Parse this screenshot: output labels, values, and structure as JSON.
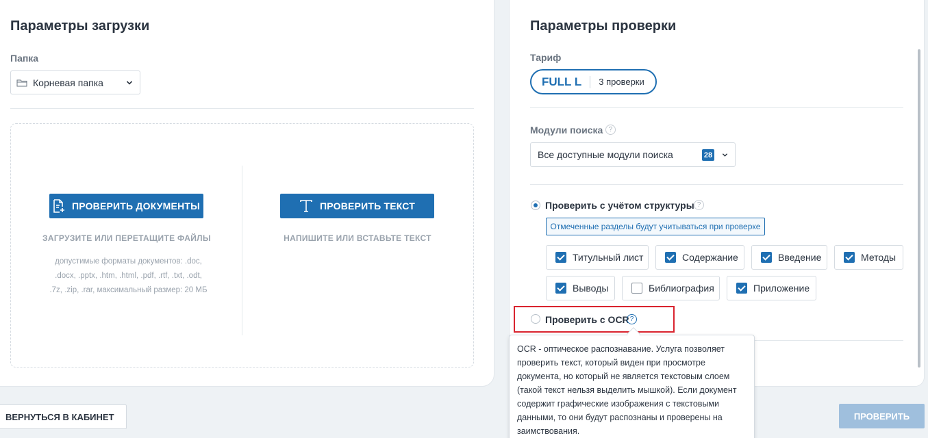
{
  "upload": {
    "title": "Параметры загрузки",
    "folder_label": "Папка",
    "folder_value": "Корневая папка",
    "check_docs_button": "ПРОВЕРИТЬ ДОКУМЕНТЫ",
    "check_docs_hint": "ЗАГРУЗИТЕ ИЛИ ПЕРЕТАЩИТЕ ФАЙЛЫ",
    "formats": [
      "допустимые форматы документов: .doc,",
      ".docx, .pptx, .htm, .html, .pdf, .rtf, .txt, .odt,",
      ".7z, .zip, .rar, максимальный размер: 20 МБ"
    ],
    "check_text_button": "ПРОВЕРИТЬ ТЕКСТ",
    "check_text_hint": "НАПИШИТЕ ИЛИ ВСТАВЬТЕ ТЕКСТ"
  },
  "check": {
    "title": "Параметры проверки",
    "tariff_label": "Тариф",
    "tariff_name": "FULL L",
    "tariff_count": "3 проверки",
    "modules_label": "Модули поиска",
    "modules_value": "Все доступные модули поиска",
    "modules_count": "28",
    "structure_option": "Проверить с учётом структуры",
    "structure_note": "Отмеченные разделы будут учитываться при проверке",
    "sections": [
      {
        "label": "Титульный лист",
        "checked": true
      },
      {
        "label": "Содержание",
        "checked": true
      },
      {
        "label": "Введение",
        "checked": true
      },
      {
        "label": "Методы",
        "checked": true
      },
      {
        "label": "Выводы",
        "checked": true
      },
      {
        "label": "Библиография",
        "checked": false
      },
      {
        "label": "Приложение",
        "checked": true
      }
    ],
    "ocr_option": "Проверить с OCR",
    "help_glyph": "?",
    "ocr_tooltip": "OCR - оптическое распознавание. Услуга позволяет проверить текст, который виден при просмотре документа, но который не является текстовым слоем (такой текст нельзя выделить мышкой). Если документ содержит графические изображения с текстовыми данными, то они будут распознаны и проверены на заимствования."
  },
  "footer": {
    "back_button": "ВЕРНУТЬСЯ В КАБИНЕТ",
    "check_button": "ПРОВЕРИТЬ"
  },
  "colors": {
    "accent": "#1f6fb2",
    "highlight": "#d9232e",
    "disabled_button": "#9fbfdd"
  }
}
